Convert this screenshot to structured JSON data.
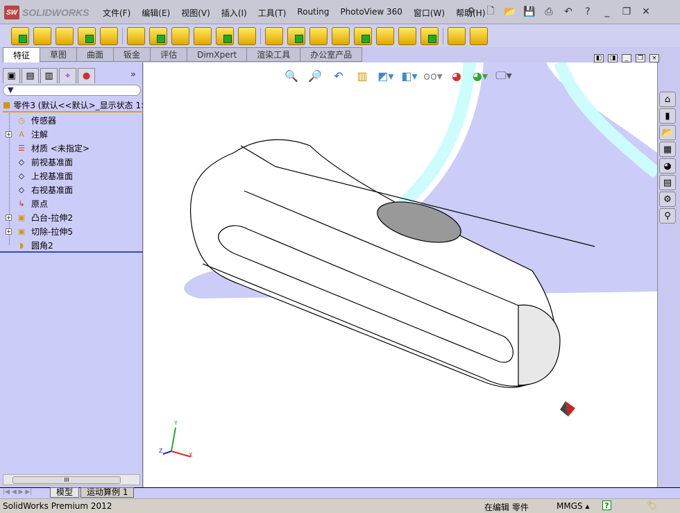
{
  "app": {
    "logo_text": "SOLIDWORKS",
    "brand_color": "#b44444"
  },
  "menu": [
    "文件(F)",
    "编辑(E)",
    "视图(V)",
    "插入(I)",
    "工具(T)",
    "Routing",
    "PhotoView 360",
    "窗口(W)",
    "帮助(H)"
  ],
  "quick_icons": [
    "pin-icon",
    "new-document-icon",
    "open-icon",
    "save-icon",
    "print-icon",
    "undo-icon",
    "help-icon",
    "minimize-icon",
    "restore-icon",
    "close-icon"
  ],
  "toolbar_icons": [
    "extruded-boss-icon",
    "revolved-boss-icon",
    "swept-boss-icon",
    "lofted-boss-icon",
    "boundary-boss-icon",
    "extruded-cut-icon",
    "hole-wizard-icon",
    "revolved-cut-icon",
    "swept-cut-icon",
    "lofted-cut-icon",
    "boundary-cut-icon",
    "fillet-icon",
    "linear-pattern-icon",
    "rib-icon",
    "draft-icon",
    "shell-icon",
    "wrap-icon",
    "intersect-icon",
    "reference-geometry-icon",
    "curves-icon",
    "instant3d-icon"
  ],
  "tabs": [
    "特征",
    "草图",
    "曲面",
    "钣金",
    "评估",
    "DimXpert",
    "渲染工具",
    "办公室产品"
  ],
  "active_tab": "特征",
  "tree": {
    "root": "零件3 (默认<<默认>_显示状态 1>)",
    "items": [
      {
        "label": "传感器",
        "icon": "sensor-folder-icon",
        "expandable": false
      },
      {
        "label": "注解",
        "icon": "annotations-icon",
        "expandable": true
      },
      {
        "label": "材质 <未指定>",
        "icon": "material-icon",
        "expandable": false
      },
      {
        "label": "前视基准面",
        "icon": "plane-icon",
        "expandable": false
      },
      {
        "label": "上视基准面",
        "icon": "plane-icon",
        "expandable": false
      },
      {
        "label": "右视基准面",
        "icon": "plane-icon",
        "expandable": false
      },
      {
        "label": "原点",
        "icon": "origin-icon",
        "expandable": false
      },
      {
        "label": "凸台-拉伸2",
        "icon": "extrude-boss-icon",
        "expandable": true
      },
      {
        "label": "切除-拉伸5",
        "icon": "extrude-cut-icon",
        "expandable": true
      },
      {
        "label": "圆角2",
        "icon": "fillet-icon",
        "expandable": false
      }
    ]
  },
  "scroll_grip": "III",
  "more": "»",
  "bottom_tabs": [
    "模型",
    "运动算例 1"
  ],
  "status": {
    "product": "SolidWorks Premium 2012",
    "mode": "在编辑 零件",
    "units": "MMGS ▴",
    "help": "?"
  },
  "triad": {
    "x": "X",
    "y": "Y",
    "z": "Z"
  }
}
